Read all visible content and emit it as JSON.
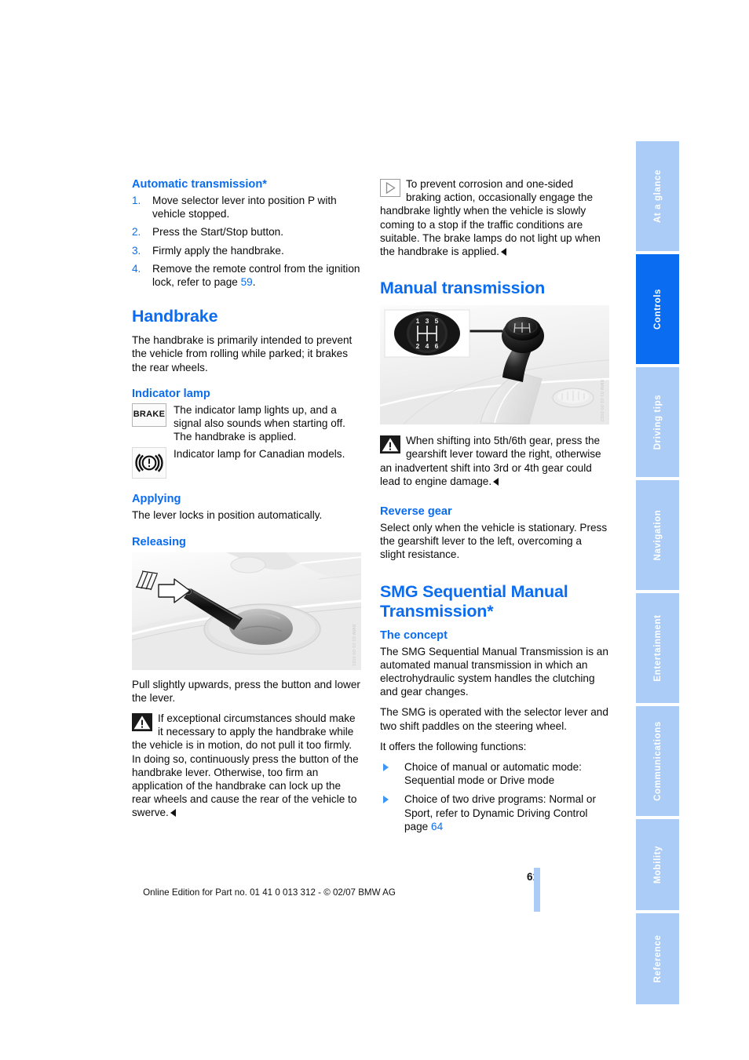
{
  "page": {
    "number": "61",
    "footer": "Online Edition for Part no. 01 41 0 013 312 - © 02/07 BMW AG"
  },
  "colors": {
    "accent_blue": "#0a6cf0",
    "tab_inactive": "#aaccf7",
    "tab_active": "#0a6cf0",
    "text": "#0a0a0a"
  },
  "tabs": [
    {
      "label": "At a glance",
      "active": false
    },
    {
      "label": "Controls",
      "active": true
    },
    {
      "label": "Driving tips",
      "active": false
    },
    {
      "label": "Navigation",
      "active": false
    },
    {
      "label": "Entertainment",
      "active": false
    },
    {
      "label": "Communications",
      "active": false
    },
    {
      "label": "Mobility",
      "active": false
    },
    {
      "label": "Reference",
      "active": false
    }
  ],
  "left_column": {
    "auto_transmission": {
      "heading": "Automatic transmission*",
      "steps": [
        {
          "num": "1.",
          "text": "Move selector lever into position P with vehicle stopped."
        },
        {
          "num": "2.",
          "text": "Press the Start/Stop button."
        },
        {
          "num": "3.",
          "text": "Firmly apply the handbrake."
        },
        {
          "num": "4a",
          "text": "Remove the remote control from the igni-tion lock, refer to page ",
          "page_ref": "59",
          "text_after": "."
        }
      ],
      "step4_prefix": "Remove the remote control from the ignition lock, refer to page ",
      "step4_ref": "59",
      "step4_suffix": "."
    },
    "handbrake": {
      "heading": "Handbrake",
      "intro": "The handbrake is primarily intended to prevent the vehicle from rolling while parked; it brakes the rear wheels.",
      "indicator": {
        "heading": "Indicator lamp",
        "lamp1_icon": "brake-lamp-icon",
        "lamp1_icon_text": "BRAKE",
        "lamp1_text": "The indicator lamp lights up, and a signal also sounds when starting off. The handbrake is applied.",
        "lamp2_icon": "canadian-brake-lamp-icon",
        "lamp2_text": "Indicator lamp for Canadian models."
      },
      "applying": {
        "heading": "Applying",
        "text": "The lever locks in position automatically."
      },
      "releasing": {
        "heading": "Releasing",
        "figure_alt": "handbrake-lever-release-illustration",
        "figure_credit": "BMW-01-01-00-0021",
        "caption": "Pull slightly upwards, press the button and lower the lever.",
        "warning": "If exceptional circumstances should make it necessary to apply the handbrake while the vehicle is in motion, do not pull it too firmly. In doing so, continuously press the button of the handbrake lever. Otherwise, too firm an application of the handbrake can lock up the rear wheels and cause the rear of the vehicle to swerve."
      }
    }
  },
  "right_column": {
    "tip": {
      "icon": "tip-triangle-icon",
      "text": "To prevent corrosion and one-sided braking action, occasionally engage the handbrake lightly when the vehicle is slowly coming to a stop if the traffic conditions are suitable. The brake lamps do not light up when the handbrake is applied."
    },
    "manual_transmission": {
      "heading": "Manual transmission",
      "figure_alt": "manual-gearshift-lever-illustration",
      "figure_credit": "BMW-01-01-00-0022",
      "shift_pattern_top": [
        "1",
        "3",
        "5"
      ],
      "shift_pattern_bottom": [
        "2",
        "4",
        "6"
      ],
      "warning": "When shifting into 5th/6th gear, press the gearshift lever toward the right, otherwise an inadvertent shift into 3rd or 4th gear could lead to engine damage.",
      "reverse": {
        "heading": "Reverse gear",
        "text": "Select only when the vehicle is stationary. Press the gearshift lever to the left, overcoming a slight resistance."
      }
    },
    "smg": {
      "heading": "SMG Sequential Manual Transmission*",
      "concept": {
        "heading": "The concept",
        "para1": "The SMG Sequential Manual Transmission is an automated manual transmission in which an electrohydraulic system handles the clutching and gear changes.",
        "para2": "The SMG is operated with the selector lever and two shift paddles on the steering wheel.",
        "para3": "It offers the following functions:"
      },
      "functions": [
        {
          "text": "Choice of manual or automatic mode: Sequential mode or Drive mode"
        },
        {
          "text_before": "Choice of two drive programs: Normal or Sport, refer to Dynamic Driving Control page ",
          "page_ref": "64",
          "text_after": ""
        }
      ]
    }
  }
}
